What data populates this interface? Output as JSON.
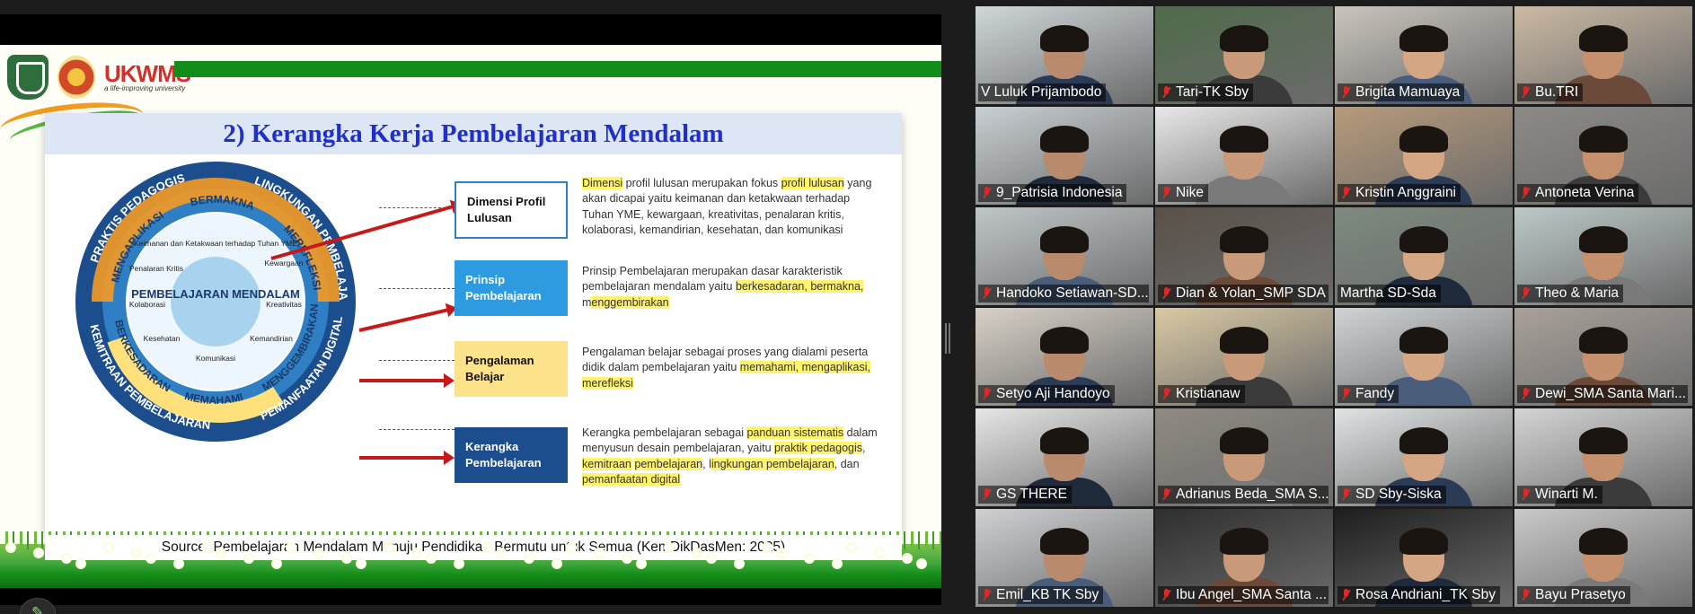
{
  "slide": {
    "brand_text": "UKWMS",
    "brand_tagline": "a life-improving university",
    "title": "2) Kerangka Kerja Pembelajaran Mendalam",
    "diagram": {
      "center": "PEMBELAJARAN MENDALAM",
      "ring_outer": [
        "PRAKTIS PEDAGOGIS",
        "LINGKUNGAN PEMBELAJARAN",
        "PEMANFAATAN DIGITAL",
        "KEMITRAAN PEMBELAJARAN"
      ],
      "ring_middle": [
        "MENGAPLIKASI",
        "MEREFLEKSI",
        "MENGGEMBIRAKAN",
        "MEMAHAMI",
        "BERKESADARAN",
        "BERMAKNA"
      ],
      "dimensions": [
        "Keimanan dan Ketakwaan terhadap Tuhan YME",
        "Kewargaan",
        "Kreativitas",
        "Kemandirian",
        "Komunikasi",
        "Kesehatan",
        "Kolaborasi",
        "Penalaran Kritis"
      ]
    },
    "rows": [
      {
        "box": "Dimensi Profil Lulusan",
        "desc_parts": [
          {
            "t": "Dimensi",
            "h": true
          },
          {
            "t": " profil lulusan merupakan fokus ",
            "h": false
          },
          {
            "t": "profil lulusan",
            "h": true
          },
          {
            "t": " yang akan dicapai yaitu keimanan dan ketakwaan terhadap Tuhan YME, kewargaan, kreativitas, penalaran kritis, kolaborasi, kemandirian, kesehatan, dan komunikasi",
            "h": false
          }
        ]
      },
      {
        "box": "Prinsip Pembelajaran",
        "desc_parts": [
          {
            "t": "Prinsip Pembelajaran merupakan dasar karakteristik pembelajaran mendalam yaitu ",
            "h": false
          },
          {
            "t": "berkesadaran, bermakna,",
            "h": true
          },
          {
            "t": " m",
            "h": false
          },
          {
            "t": "enggembirakan",
            "h": true
          }
        ]
      },
      {
        "box": "Pengalaman Belajar",
        "desc_parts": [
          {
            "t": "Pengalaman belajar sebagai proses yang dialami peserta didik dalam pembelajaran yaitu ",
            "h": false
          },
          {
            "t": "memahami, mengaplikasi, merefleksi",
            "h": true
          }
        ]
      },
      {
        "box": "Kerangka Pembelajaran",
        "desc_parts": [
          {
            "t": "Kerangka pembelajaran sebagai ",
            "h": false
          },
          {
            "t": "panduan sistematis",
            "h": true
          },
          {
            "t": " dalam menyusun desain pembelajaran, yaitu ",
            "h": false
          },
          {
            "t": "praktik pedagogis",
            "h": true
          },
          {
            "t": ", ",
            "h": false
          },
          {
            "t": "kemitraan",
            "h": true
          },
          {
            "t": " ",
            "h": false
          },
          {
            "t": "pembelajaran",
            "h": true
          },
          {
            "t": ", l",
            "h": false
          },
          {
            "t": "ingkungan pembelajaran",
            "h": true
          },
          {
            "t": ", dan ",
            "h": false
          },
          {
            "t": "pemanfaatan digital",
            "h": true
          }
        ]
      }
    ],
    "source": "Source: Pembelajaran Mendalam Menuju Pendidikan Bermutu untuk Semua (KemDikDasMen: 2025)"
  },
  "participants": [
    {
      "name": "V Luluk Prijambodo",
      "muted": false,
      "active": true
    },
    {
      "name": "Tari-TK Sby",
      "muted": true
    },
    {
      "name": "Brigita Mamuaya",
      "muted": true
    },
    {
      "name": "Bu.TRI",
      "muted": true
    },
    {
      "name": "9_Patrisia Indonesia",
      "muted": true
    },
    {
      "name": "Nike",
      "muted": true
    },
    {
      "name": "Kristin Anggraini",
      "muted": true
    },
    {
      "name": "Antoneta Verina",
      "muted": true
    },
    {
      "name": "Handoko Setiawan-SD...",
      "muted": true
    },
    {
      "name": "Dian & Yolan_SMP SDA",
      "muted": true
    },
    {
      "name": "Martha SD-Sda",
      "muted": false
    },
    {
      "name": "Theo & Maria",
      "muted": true
    },
    {
      "name": "Setyo Aji Handoyo",
      "muted": true
    },
    {
      "name": "Kristianaw",
      "muted": true
    },
    {
      "name": "Fandy",
      "muted": true
    },
    {
      "name": "Dewi_SMA Santa Mari...",
      "muted": true
    },
    {
      "name": "GS THERE",
      "muted": true
    },
    {
      "name": "Adrianus Beda_SMA S...",
      "muted": true
    },
    {
      "name": "SD Sby-Siska",
      "muted": true
    },
    {
      "name": "Winarti M.",
      "muted": true
    },
    {
      "name": "Emil_KB TK Sby",
      "muted": true
    },
    {
      "name": "Ibu Angel_SMA Santa ...",
      "muted": true
    },
    {
      "name": "Rosa Andriani_TK Sby",
      "muted": true
    },
    {
      "name": "Bayu Prasetyo",
      "muted": true
    }
  ],
  "colors": {
    "active_border": "#23d18b",
    "title": "#1f2fc9",
    "highlight": "#fff36b",
    "arrow": "#c61a1a"
  },
  "icons": {
    "edit": "pencil-icon",
    "mute": "mic-muted-icon"
  }
}
